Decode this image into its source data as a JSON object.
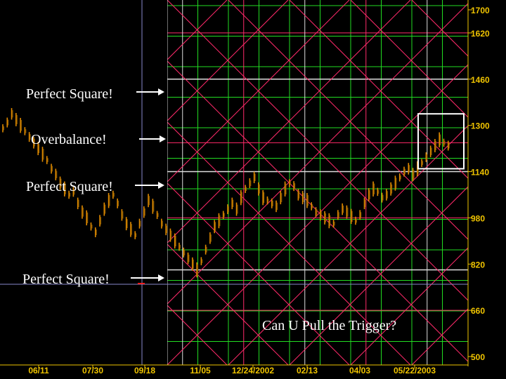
{
  "chart_data": {
    "type": "bar",
    "title": "",
    "xlabel": "",
    "ylabel": "",
    "ylim": [
      500,
      1700
    ],
    "y_ticks": [
      500,
      660,
      820,
      980,
      1140,
      1300,
      1460,
      1620,
      1700
    ],
    "x_ticks": [
      "06/11",
      "07/30",
      "09/18",
      "11/05",
      "12/24/2002",
      "02/13",
      "04/03",
      "05/22/2003"
    ],
    "grid": true,
    "price_series": {
      "name": "",
      "points": [
        [
          0,
          1290
        ],
        [
          2,
          1310
        ],
        [
          4,
          1340
        ],
        [
          6,
          1320
        ],
        [
          8,
          1300
        ],
        [
          10,
          1280
        ],
        [
          12,
          1260
        ],
        [
          14,
          1240
        ],
        [
          16,
          1220
        ],
        [
          18,
          1200
        ],
        [
          20,
          1180
        ],
        [
          22,
          1150
        ],
        [
          24,
          1130
        ],
        [
          26,
          1100
        ],
        [
          28,
          1080
        ],
        [
          30,
          1060
        ],
        [
          32,
          1070
        ],
        [
          34,
          1030
        ],
        [
          36,
          1000
        ],
        [
          38,
          980
        ],
        [
          40,
          950
        ],
        [
          42,
          930
        ],
        [
          44,
          970
        ],
        [
          46,
          1010
        ],
        [
          48,
          1040
        ],
        [
          50,
          1060
        ],
        [
          52,
          1030
        ],
        [
          54,
          990
        ],
        [
          56,
          960
        ],
        [
          58,
          940
        ],
        [
          60,
          920
        ],
        [
          62,
          960
        ],
        [
          64,
          1000
        ],
        [
          66,
          1040
        ],
        [
          68,
          1020
        ],
        [
          70,
          990
        ],
        [
          72,
          960
        ],
        [
          74,
          940
        ],
        [
          76,
          920
        ],
        [
          78,
          900
        ],
        [
          80,
          880
        ],
        [
          82,
          860
        ],
        [
          84,
          840
        ],
        [
          86,
          820
        ],
        [
          88,
          800
        ],
        [
          90,
          830
        ],
        [
          92,
          870
        ],
        [
          94,
          910
        ],
        [
          96,
          950
        ],
        [
          98,
          970
        ],
        [
          100,
          990
        ],
        [
          102,
          1010
        ],
        [
          104,
          1030
        ],
        [
          106,
          1010
        ],
        [
          108,
          1050
        ],
        [
          110,
          1080
        ],
        [
          112,
          1100
        ],
        [
          114,
          1120
        ],
        [
          116,
          1080
        ],
        [
          118,
          1050
        ],
        [
          120,
          1040
        ],
        [
          122,
          1030
        ],
        [
          124,
          1020
        ],
        [
          126,
          1050
        ],
        [
          128,
          1080
        ],
        [
          130,
          1100
        ],
        [
          132,
          1090
        ],
        [
          134,
          1060
        ],
        [
          136,
          1050
        ],
        [
          138,
          1040
        ],
        [
          140,
          1020
        ],
        [
          142,
          1000
        ],
        [
          144,
          990
        ],
        [
          146,
          980
        ],
        [
          148,
          970
        ],
        [
          150,
          960
        ],
        [
          152,
          990
        ],
        [
          154,
          1010
        ],
        [
          156,
          1000
        ],
        [
          158,
          985
        ],
        [
          160,
          970
        ],
        [
          162,
          990
        ],
        [
          164,
          1030
        ],
        [
          166,
          1060
        ],
        [
          168,
          1080
        ],
        [
          170,
          1070
        ],
        [
          172,
          1050
        ],
        [
          174,
          1060
        ],
        [
          176,
          1080
        ],
        [
          178,
          1100
        ],
        [
          180,
          1120
        ],
        [
          182,
          1140
        ],
        [
          184,
          1150
        ],
        [
          186,
          1130
        ],
        [
          188,
          1150
        ],
        [
          190,
          1170
        ],
        [
          192,
          1190
        ],
        [
          194,
          1210
        ],
        [
          196,
          1230
        ],
        [
          198,
          1250
        ],
        [
          200,
          1240
        ],
        [
          202,
          1230
        ]
      ]
    },
    "annotations": [
      {
        "text": "Perfect Square!",
        "price": 1460
      },
      {
        "text": "Overbalance!",
        "price": 1240
      },
      {
        "text": "Perfect Square!",
        "price": 1140
      },
      {
        "text": "Perfect Square!",
        "price": 800
      },
      {
        "text": "Can U Pull the Trigger?",
        "price": 655
      }
    ],
    "highlight_box": {
      "from_price": 1150,
      "to_price": 1340
    }
  },
  "colors": {
    "background": "#000000",
    "grid_green": "#22dd22",
    "grid_pink": "#ff2a6a",
    "grid_white": "#dddddd",
    "axis_text": "#f0c400",
    "bars": "#e08a00",
    "bars_dark": "#8a5a00",
    "annotation": "#ffffff",
    "cursor_line": "#8888cc"
  }
}
